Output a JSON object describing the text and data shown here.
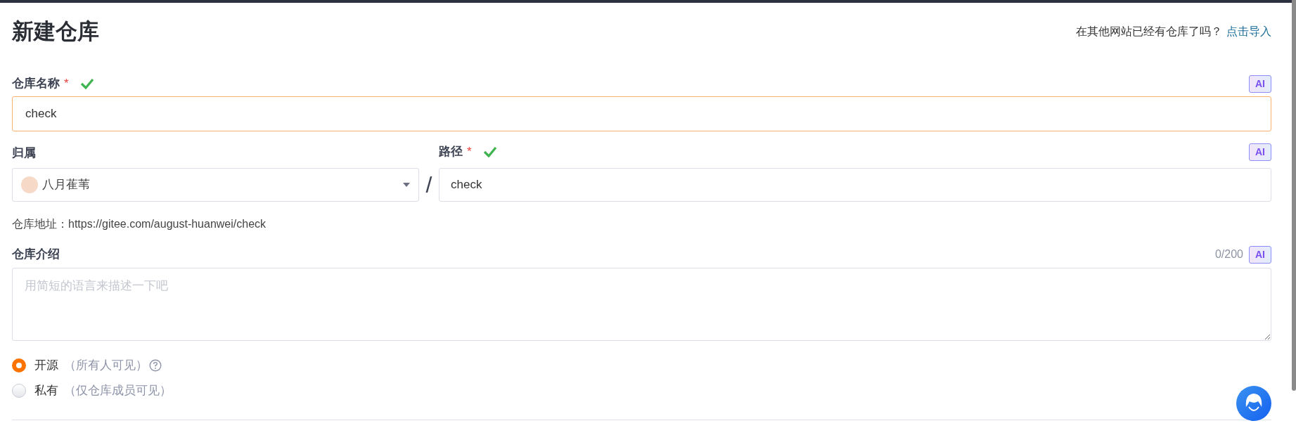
{
  "title": "新建仓库",
  "import_prompt": {
    "text": "在其他网站已经有仓库了吗？",
    "link": "点击导入"
  },
  "name_field": {
    "label": "仓库名称",
    "required_mark": "*",
    "valid": true,
    "ai_badge": "AI",
    "value": "check",
    "focused": true
  },
  "owner_field": {
    "label": "归属",
    "value": "八月萑苇"
  },
  "separator": "/",
  "path_field": {
    "label": "路径",
    "required_mark": "*",
    "valid": true,
    "ai_badge": "AI",
    "value": "check"
  },
  "repo_address": "仓库地址：https://gitee.com/august-huanwei/check",
  "description_field": {
    "label": "仓库介绍",
    "counter": "0/200",
    "ai_badge": "AI",
    "placeholder": "用简短的语言来描述一下吧"
  },
  "visibility": [
    {
      "label": "开源",
      "hint": "（所有人可见）",
      "selected": true,
      "help": true
    },
    {
      "label": "私有",
      "hint": "（仅仓库成员可见）",
      "selected": false,
      "help": false
    }
  ]
}
